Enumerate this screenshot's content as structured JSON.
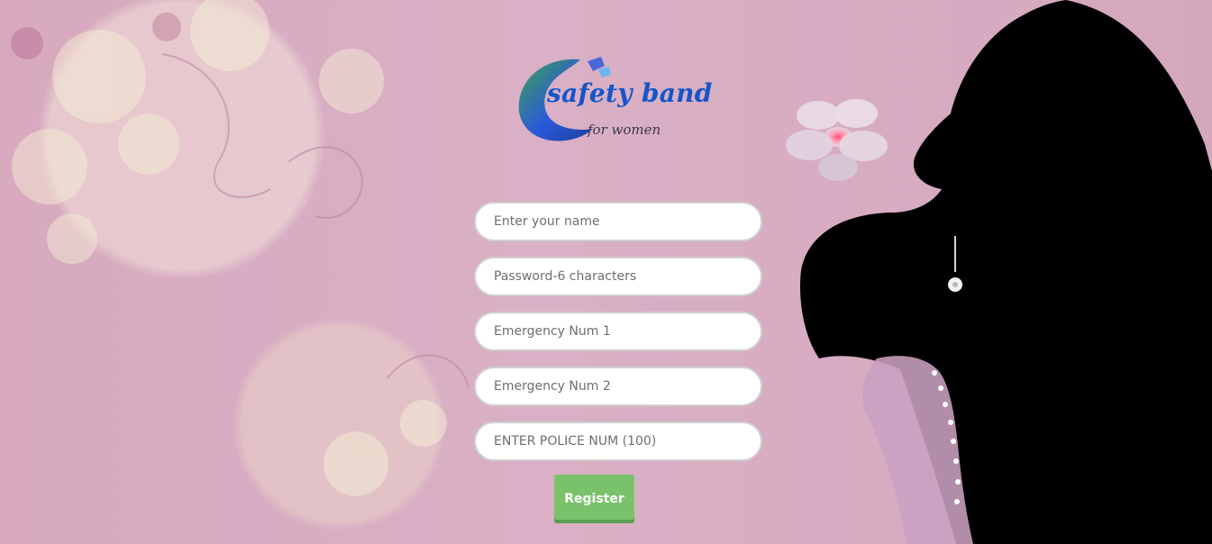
{
  "brand": {
    "name": "safety band",
    "tagline": "for women",
    "colors": {
      "primary": "#1555c9",
      "accent_green": "#3ea44e",
      "accent_blue": "#2a5ad8",
      "button": "#79c26b",
      "background": "#d8abc1"
    }
  },
  "form": {
    "fields": {
      "name": {
        "placeholder": "Enter your name",
        "value": ""
      },
      "password": {
        "placeholder": "Password-6 characters",
        "value": ""
      },
      "emergency_1": {
        "placeholder": "Emergency Num 1",
        "value": ""
      },
      "emergency_2": {
        "placeholder": "Emergency Num 2",
        "value": ""
      },
      "police": {
        "placeholder": "ENTER POLICE NUM (100)",
        "value": ""
      }
    },
    "submit_label": "Register"
  },
  "decor": {
    "background": "floral-pattern",
    "figure": "woman-silhouette",
    "flower_icon": "pink-flower-icon",
    "earring_icon": "pendant-icon"
  }
}
